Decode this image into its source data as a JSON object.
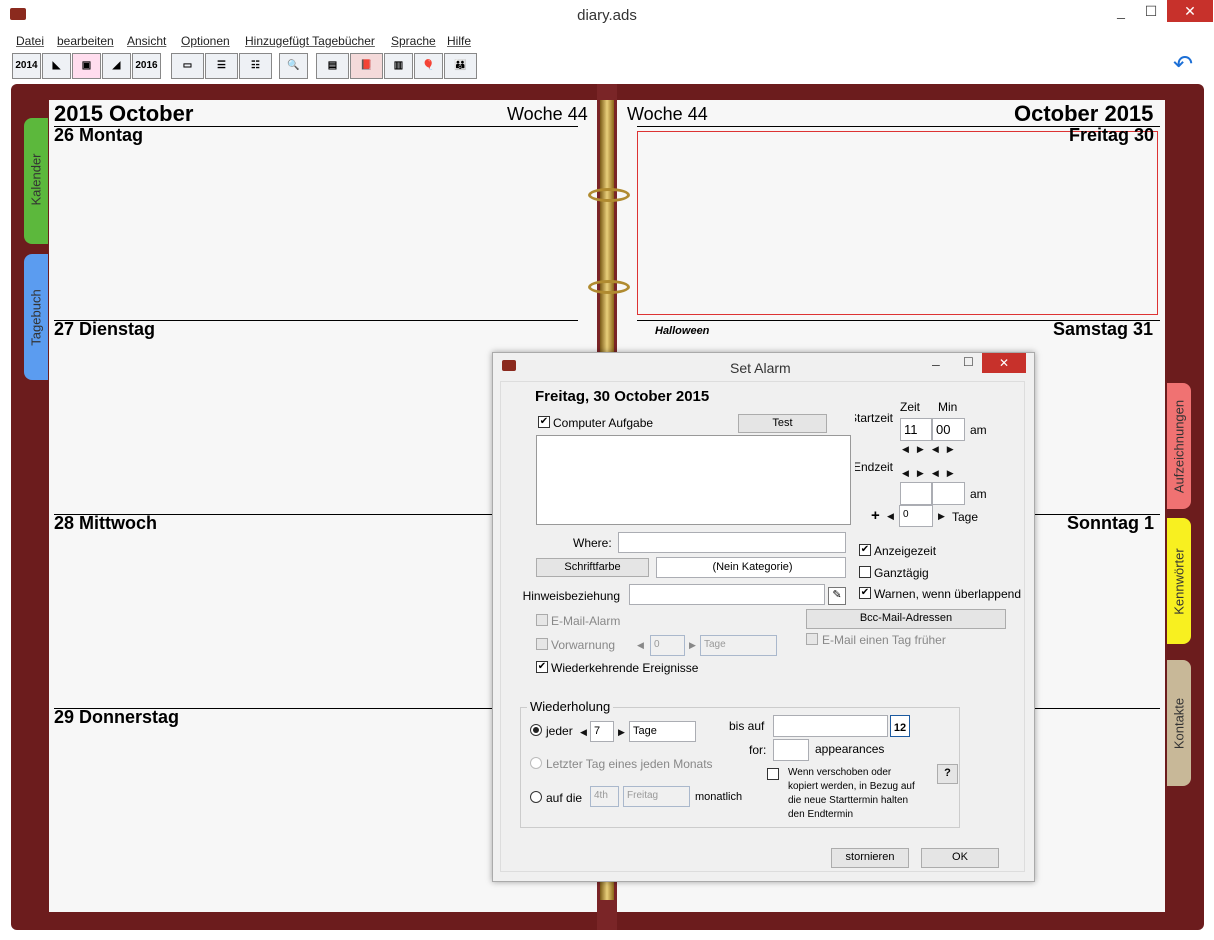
{
  "window": {
    "title": "diary.ads",
    "minimize": "_",
    "maximize": "☐",
    "close": "✕"
  },
  "menu": [
    "Datei",
    "bearbeiten",
    "Ansicht",
    "Optionen",
    "Hinzugefügt Tagebücher",
    "Sprache",
    "Hilfe"
  ],
  "toolbar": {
    "year_prev": "2014",
    "year_next": "2016"
  },
  "left_page": {
    "header": "2015 October",
    "week": "Woche 44",
    "days": [
      "26 Montag",
      "27 Dienstag",
      "28 Mittwoch",
      "29 Donnerstag"
    ]
  },
  "right_page": {
    "week": "Woche 44",
    "header": "October 2015",
    "days": [
      "Freitag 30",
      "Samstag 31",
      "Sonntag 1"
    ],
    "event": "Halloween"
  },
  "tabs": {
    "left": [
      "Kalender",
      "Tagebuch"
    ],
    "right": [
      "Aufzeichnungen",
      "Kennwörter",
      "Kontakte"
    ]
  },
  "dialog": {
    "title": "Set Alarm",
    "date": "Freitag, 30 October 2015",
    "computer_task": "Computer Aufgabe",
    "test": "Test",
    "start_label": "Startzeit",
    "end_label": "Endzeit",
    "time_label": "Zeit",
    "min_label": "Min",
    "start_hour": "11",
    "start_min": "00",
    "ampm": "am",
    "end_ampm": "am",
    "plus": "+",
    "days_value": "0",
    "days_label": "Tage",
    "where_label": "Where:",
    "schriftfarbe": "Schriftfarbe",
    "category": "(Nein Kategorie)",
    "hinweis": "Hinweisbeziehung",
    "anzeigezeit": "Anzeigezeit",
    "ganztaegig": "Ganztägig",
    "warnen": "Warnen, wenn überlappend",
    "email_alarm": "E-Mail-Alarm",
    "bcc": "Bcc-Mail-Adressen",
    "email_early": "E-Mail einen Tag früher",
    "vorwarnung": "Vorwarnung",
    "vor_value": "0",
    "vor_unit": "Tage",
    "wiederkehrend": "Wiederkehrende Ereignisse",
    "wiederholung": "Wiederholung",
    "jeder": "jeder",
    "jeder_value": "7",
    "jeder_unit": "Tage",
    "bis_auf": "bis auf",
    "for": "for:",
    "appearances": "appearances",
    "cal_icon": "12",
    "letzter": "Letzter Tag eines jeden Monats",
    "auf_die": "auf die",
    "nth": "4th",
    "weekday": "Freitag",
    "monatlich": "monatlich",
    "moved_text": [
      "Wenn verschoben oder",
      "kopiert werden, in Bezug auf",
      "die neue Starttermin halten",
      "den Endtermin"
    ],
    "help": "?",
    "cancel": "stornieren",
    "ok": "OK"
  }
}
